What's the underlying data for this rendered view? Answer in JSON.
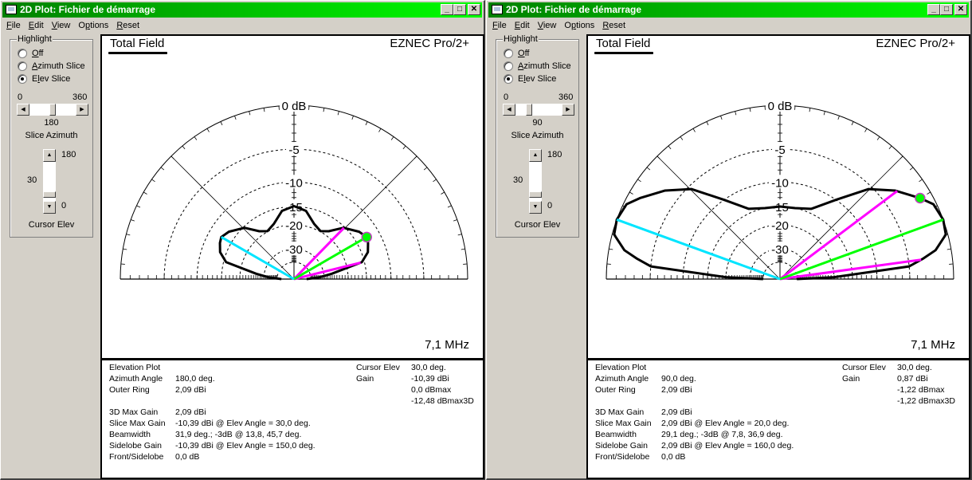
{
  "windows": [
    {
      "title": "2D Plot: Fichier de démarrage",
      "menu": [
        {
          "label": "File",
          "ul": "F",
          "rest": "ile",
          "active": false
        },
        {
          "label": "Edit",
          "ul": "E",
          "rest": "dit",
          "active": true
        },
        {
          "label": "View",
          "ul": "V",
          "rest": "iew",
          "active": false
        },
        {
          "label": "Options",
          "ul": "O",
          "pre": "",
          "rest": "ptions",
          "active": false
        },
        {
          "label": "Reset",
          "ul": "R",
          "rest": "eset",
          "active": false
        }
      ],
      "highlight": {
        "legend": "Highlight",
        "options": [
          {
            "label": "Off",
            "checked": false
          },
          {
            "label": "Azimuth Slice",
            "checked": false
          },
          {
            "label": "Elev Slice",
            "checked": true
          }
        ]
      },
      "slice_azimuth": {
        "min": "0",
        "max": "360",
        "value": "180",
        "value_fraction": 0.5,
        "label": "Slice Azimuth"
      },
      "cursor_elev": {
        "max": "180",
        "min": "0",
        "value": "30",
        "label": "Cursor Elev"
      },
      "plot": {
        "title": "Total Field",
        "brand": "EZNEC Pro/2+",
        "frequency": "7,1 MHz",
        "ring_labels": [
          "0 dB",
          "-5",
          "-10",
          "-15",
          "-20",
          "-30"
        ]
      },
      "info": {
        "left": [
          {
            "label": "Elevation Plot",
            "value": ""
          },
          {
            "label": "Azimuth Angle",
            "value": "180,0 deg."
          },
          {
            "label": "Outer Ring",
            "value": "2,09 dBi"
          },
          {
            "label": "",
            "value": ""
          },
          {
            "label": "3D Max Gain",
            "value": "2,09 dBi"
          },
          {
            "label": "Slice Max Gain",
            "value": "-10,39 dBi @ Elev Angle = 30,0 deg."
          },
          {
            "label": "Beamwidth",
            "value": "31,9 deg.; -3dB @ 13,8, 45,7 deg."
          },
          {
            "label": "Sidelobe Gain",
            "value": "-10,39 dBi @ Elev Angle = 150,0 deg."
          },
          {
            "label": "Front/Sidelobe",
            "value": "0,0 dB"
          }
        ],
        "right": [
          {
            "label": "Cursor Elev",
            "value": "30,0 deg."
          },
          {
            "label": "Gain",
            "value": "-10,39 dBi"
          },
          {
            "label": "",
            "value": "0,0 dBmax"
          },
          {
            "label": "",
            "value": "-12,48 dBmax3D"
          }
        ]
      }
    },
    {
      "title": "2D Plot: Fichier de démarrage",
      "menu": [
        {
          "label": "File",
          "ul": "F",
          "rest": "ile",
          "active": false
        },
        {
          "label": "Edit",
          "ul": "E",
          "rest": "dit",
          "active": false
        },
        {
          "label": "View",
          "ul": "V",
          "rest": "iew",
          "active": false
        },
        {
          "label": "Options",
          "ul": "O",
          "rest": "ptions",
          "active": false
        },
        {
          "label": "Reset",
          "ul": "R",
          "rest": "eset",
          "active": false
        }
      ],
      "highlight": {
        "legend": "Highlight",
        "options": [
          {
            "label": "Off",
            "checked": false
          },
          {
            "label": "Azimuth Slice",
            "checked": false
          },
          {
            "label": "Elev Slice",
            "checked": true
          }
        ]
      },
      "slice_azimuth": {
        "min": "0",
        "max": "360",
        "value": "90",
        "value_fraction": 0.25,
        "label": "Slice Azimuth"
      },
      "cursor_elev": {
        "max": "180",
        "min": "0",
        "value": "30",
        "label": "Cursor Elev"
      },
      "plot": {
        "title": "Total Field",
        "brand": "EZNEC Pro/2+",
        "frequency": "7,1 MHz",
        "ring_labels": [
          "0 dB",
          "-5",
          "-10",
          "-15",
          "-20",
          "-30"
        ]
      },
      "info": {
        "left": [
          {
            "label": "Elevation Plot",
            "value": ""
          },
          {
            "label": "Azimuth Angle",
            "value": "90,0 deg."
          },
          {
            "label": "Outer Ring",
            "value": "2,09 dBi"
          },
          {
            "label": "",
            "value": ""
          },
          {
            "label": "3D Max Gain",
            "value": "2,09 dBi"
          },
          {
            "label": "Slice Max Gain",
            "value": "2,09 dBi @ Elev Angle = 20,0 deg."
          },
          {
            "label": "Beamwidth",
            "value": "29,1 deg.; -3dB @ 7,8, 36,9 deg."
          },
          {
            "label": "Sidelobe Gain",
            "value": "2,09 dBi @ Elev Angle = 160,0 deg."
          },
          {
            "label": "Front/Sidelobe",
            "value": "0,0 dB"
          }
        ],
        "right": [
          {
            "label": "Cursor Elev",
            "value": "30,0 deg."
          },
          {
            "label": "Gain",
            "value": "0,87 dBi"
          },
          {
            "label": "",
            "value": "-1,22 dBmax"
          },
          {
            "label": "",
            "value": "-1,22 dBmax3D"
          }
        ]
      }
    }
  ],
  "colors": {
    "titlebar_start": "#008000",
    "titlebar_end": "#00ff00",
    "pattern": "#000000",
    "beamwidth_lines": "#ff00ff",
    "max_gain_line": "#00ff00",
    "sidelobe_line": "#00e5ff",
    "cursor_marker": "#00ff00"
  },
  "chart_data": [
    {
      "type": "polar-elevation",
      "title": "Total Field",
      "scale": "ARRL log (0.89^(dB/2))",
      "outer_ring_dBi": 2.09,
      "ring_values_dB": [
        0,
        -5,
        -10,
        -15,
        -20,
        -30
      ],
      "azimuth_deg": 180,
      "pattern_rel_dB": {
        "elev_deg": [
          0,
          4,
          8,
          14,
          20,
          26,
          30,
          36,
          46,
          54,
          61,
          70,
          80,
          90,
          100,
          110,
          119,
          126,
          134,
          144,
          150,
          154,
          160,
          166,
          172,
          176,
          180
        ],
        "gain_dB": [
          -45,
          -33,
          -26,
          -15.6,
          -13.6,
          -12.8,
          -12.48,
          -13.2,
          -15.3,
          -18.5,
          -19.8,
          -18.6,
          -15.8,
          -14.9,
          -15.8,
          -18.6,
          -19.8,
          -18.5,
          -15.3,
          -13.2,
          -12.48,
          -12.8,
          -13.6,
          -15.6,
          -26,
          -33,
          -45
        ]
      },
      "cursor_elev_deg": 30,
      "max_gain_elev_deg": 30,
      "beamwidth_elev_deg": [
        13.8,
        45.7
      ],
      "sidelobe_elev_deg": 150
    },
    {
      "type": "polar-elevation",
      "title": "Total Field",
      "scale": "ARRL log (0.89^(dB/2))",
      "outer_ring_dBi": 2.09,
      "ring_values_dB": [
        0,
        -5,
        -10,
        -15,
        -20,
        -30
      ],
      "azimuth_deg": 90,
      "pattern_rel_dB": {
        "elev_deg": [
          0,
          2,
          5.6,
          8.2,
          10.5,
          15,
          20,
          26,
          30,
          37.6,
          45.5,
          54.5,
          66,
          78,
          90,
          102,
          114,
          125.5,
          134.5,
          142.4,
          150,
          154,
          160,
          165,
          169.5,
          171.8,
          174.4,
          178,
          180
        ],
        "gain_dB": [
          -40,
          -20,
          -5,
          -3.1,
          -1.6,
          -0.2,
          0,
          -0.3,
          -1.22,
          -3.1,
          -5.5,
          -9.9,
          -14,
          -15,
          -15,
          -15,
          -14,
          -9.9,
          -5.5,
          -3.1,
          -1.22,
          -0.3,
          0,
          -0.2,
          -1.6,
          -3.1,
          -5,
          -20,
          -40
        ]
      },
      "cursor_elev_deg": 30,
      "max_gain_elev_deg": 20,
      "beamwidth_elev_deg": [
        7.8,
        36.9
      ],
      "sidelobe_elev_deg": 160
    }
  ]
}
